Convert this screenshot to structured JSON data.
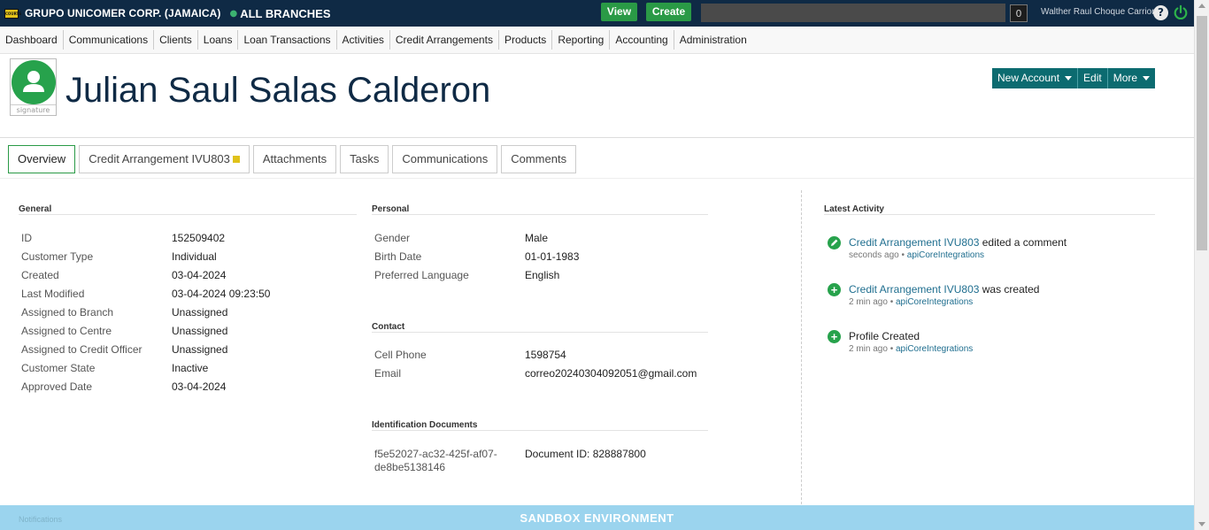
{
  "topbar": {
    "logo_text": "COURTS",
    "org_name": "GRUPO UNICOMER CORP. (JAMAICA)",
    "branch": "ALL BRANCHES",
    "view_label": "View",
    "create_label": "Create",
    "search_value": "",
    "count": "0",
    "user_name": "Walther Raul Choque Carrion",
    "help_icon": "?",
    "power_icon": "power-icon"
  },
  "nav": {
    "items": [
      "Dashboard",
      "Communications",
      "Clients",
      "Loans",
      "Loan Transactions",
      "Activities",
      "Credit Arrangements",
      "Products",
      "Reporting",
      "Accounting",
      "Administration"
    ]
  },
  "header": {
    "client_name": "Julian Saul Salas Calderon",
    "signature_label": "signature",
    "actions": {
      "new_account": "New Account",
      "edit": "Edit",
      "more": "More"
    }
  },
  "tabs": [
    {
      "label": "Overview",
      "active": true
    },
    {
      "label": "Credit Arrangement IVU803",
      "badge": true
    },
    {
      "label": "Attachments"
    },
    {
      "label": "Tasks"
    },
    {
      "label": "Communications"
    },
    {
      "label": "Comments"
    }
  ],
  "general": {
    "title": "General",
    "rows": [
      {
        "key": "ID",
        "value": "152509402"
      },
      {
        "key": "Customer Type",
        "value": "Individual"
      },
      {
        "key": "Created",
        "value": "03-04-2024"
      },
      {
        "key": "Last Modified",
        "value": "03-04-2024 09:23:50"
      },
      {
        "key": "Assigned to Branch",
        "value": "Unassigned"
      },
      {
        "key": "Assigned to Centre",
        "value": "Unassigned"
      },
      {
        "key": "Assigned to Credit Officer",
        "value": "Unassigned"
      },
      {
        "key": "Customer State",
        "value": "Inactive"
      },
      {
        "key": "Approved Date",
        "value": "03-04-2024"
      }
    ]
  },
  "personal": {
    "title": "Personal",
    "rows": [
      {
        "key": "Gender",
        "value": "Male"
      },
      {
        "key": "Birth Date",
        "value": "01-01-1983"
      },
      {
        "key": "Preferred Language",
        "value": "English"
      }
    ]
  },
  "contact": {
    "title": "Contact",
    "rows": [
      {
        "key": "Cell Phone",
        "value": "1598754"
      },
      {
        "key": "Email",
        "value": "correo20240304092051@gmail.com"
      }
    ]
  },
  "identification": {
    "title": "Identification Documents",
    "doc_key_line1": "f5e52027-ac32-425f-af07-",
    "doc_key_line2": "de8be5138146",
    "doc_value": "Document ID: 828887800"
  },
  "activity": {
    "title": "Latest Activity",
    "items": [
      {
        "icon": "edit-icon",
        "link": "Credit Arrangement IVU803",
        "text": " edited a comment",
        "time": "seconds ago",
        "sep": " • ",
        "user": "apiCoreIntegrations"
      },
      {
        "icon": "plus-icon",
        "link": "Credit Arrangement IVU803",
        "text": " was created",
        "time": "2 min ago",
        "sep": " • ",
        "user": "apiCoreIntegrations"
      },
      {
        "icon": "plus-icon",
        "link": "",
        "text": "Profile Created",
        "time": "2 min ago",
        "sep": " • ",
        "user": "apiCoreIntegrations"
      }
    ]
  },
  "footer": {
    "notifications": "Notifications",
    "sandbox": "SANDBOX ENVIRONMENT"
  },
  "colors": {
    "topbar": "#0f2a45",
    "accent_green": "#2a9a46",
    "action_teal": "#0c6b70",
    "sandbox": "#9bd4ee"
  }
}
